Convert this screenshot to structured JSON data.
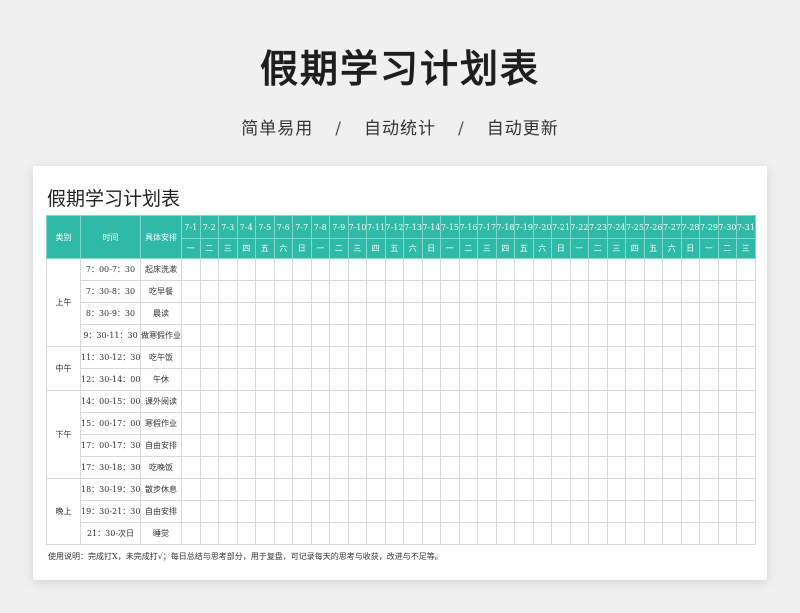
{
  "header": {
    "title": "假期学习计划表",
    "tags": [
      "简单易用",
      "自动统计",
      "自动更新"
    ],
    "separator": "/"
  },
  "sheet": {
    "title": "假期学习计划表",
    "headers": {
      "category": "类别",
      "time": "时间",
      "arrangement": "具体安排"
    },
    "dates": [
      "7-1",
      "7-2",
      "7-3",
      "7-4",
      "7-5",
      "7-6",
      "7-7",
      "7-8",
      "7-9",
      "7-10",
      "7-11",
      "7-12",
      "7-13",
      "7-14",
      "7-15",
      "7-16",
      "7-17",
      "7-18",
      "7-19",
      "7-20",
      "7-21",
      "7-22",
      "7-23",
      "7-24",
      "7-25",
      "7-26",
      "7-27",
      "7-28",
      "7-29",
      "7-30",
      "7-31"
    ],
    "weekdays": [
      "一",
      "二",
      "三",
      "四",
      "五",
      "六",
      "日",
      "一",
      "二",
      "三",
      "四",
      "五",
      "六",
      "日",
      "一",
      "二",
      "三",
      "四",
      "五",
      "六",
      "日",
      "一",
      "二",
      "三",
      "四",
      "五",
      "六",
      "日",
      "一",
      "二",
      "三"
    ],
    "groups": [
      {
        "category": "上午",
        "rows": [
          {
            "time": "7：00-7：30",
            "activity": "起床洗漱"
          },
          {
            "time": "7：30-8：30",
            "activity": "吃早餐"
          },
          {
            "time": "8：30-9：30",
            "activity": "晨读"
          },
          {
            "time": "9：30-11：30",
            "activity": "做寒假作业"
          }
        ]
      },
      {
        "category": "中午",
        "rows": [
          {
            "time": "11：30-12：30",
            "activity": "吃午饭"
          },
          {
            "time": "12：30-14：00",
            "activity": "午休"
          }
        ]
      },
      {
        "category": "下午",
        "rows": [
          {
            "time": "14：00-15：00",
            "activity": "课外阅读"
          },
          {
            "time": "15：00-17：00",
            "activity": "寒假作业"
          },
          {
            "time": "17：00-17：30",
            "activity": "自由安排"
          },
          {
            "time": "17：30-18：30",
            "activity": "吃晚饭"
          }
        ]
      },
      {
        "category": "晚上",
        "rows": [
          {
            "time": "18：30-19：30",
            "activity": "散步休息"
          },
          {
            "time": "19：30-21：30",
            "activity": "自由安排"
          },
          {
            "time": "21：30-次日",
            "activity": "睡觉"
          }
        ]
      }
    ],
    "note": "使用说明：完成打X，未完成打√；每日总结与思考部分，用于复盘，可记录每天的思考与收获，改进与不足等。",
    "accent_color": "#2ebaa6"
  }
}
